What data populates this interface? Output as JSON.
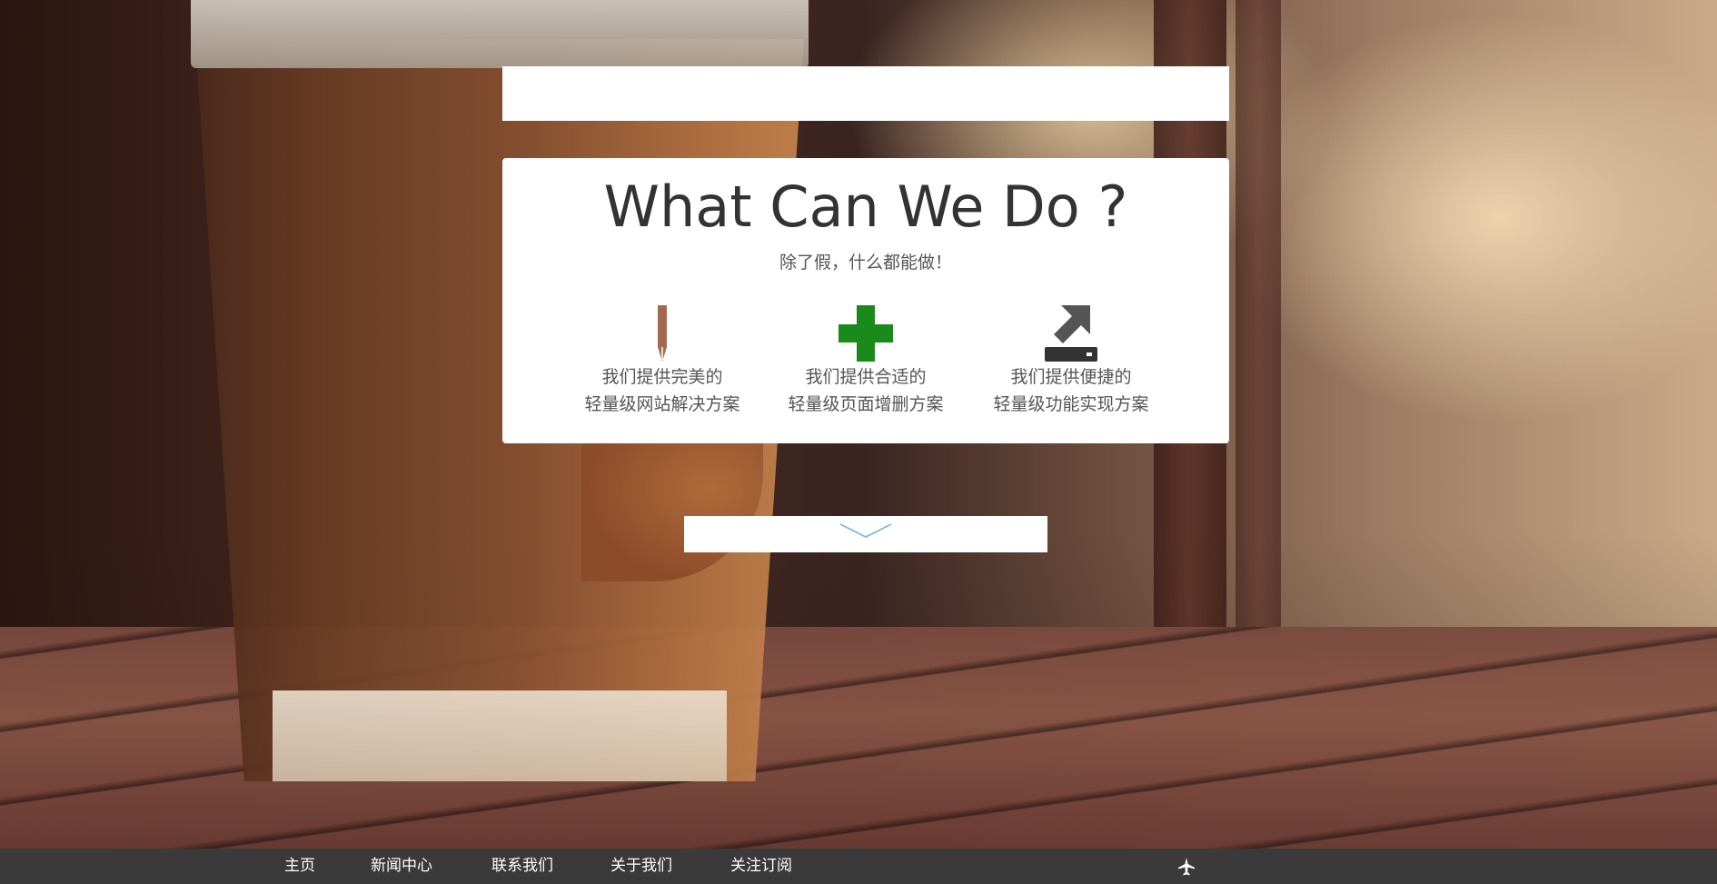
{
  "card": {
    "title": "What Can We Do ?",
    "subtitle": "除了假，什么都能做！"
  },
  "features": [
    {
      "icon": "pen-icon",
      "line1": "我们提供完美的",
      "line2": "轻量级网站解决方案"
    },
    {
      "icon": "plus-icon",
      "line1": "我们提供合适的",
      "line2": "轻量级页面增删方案"
    },
    {
      "icon": "download-drive-icon",
      "line1": "我们提供便捷的",
      "line2": "轻量级功能实现方案"
    }
  ],
  "nav": {
    "items": [
      "主页",
      "新闻中心",
      "联系我们",
      "关于我们",
      "关注订阅"
    ],
    "right_icon": "airplane-icon"
  },
  "colors": {
    "plus_green": "#1a8a1a",
    "pen_brown": "#a36a50",
    "nav_bg": "#3a3a3a",
    "arrow_blue": "#7ab8e6"
  }
}
